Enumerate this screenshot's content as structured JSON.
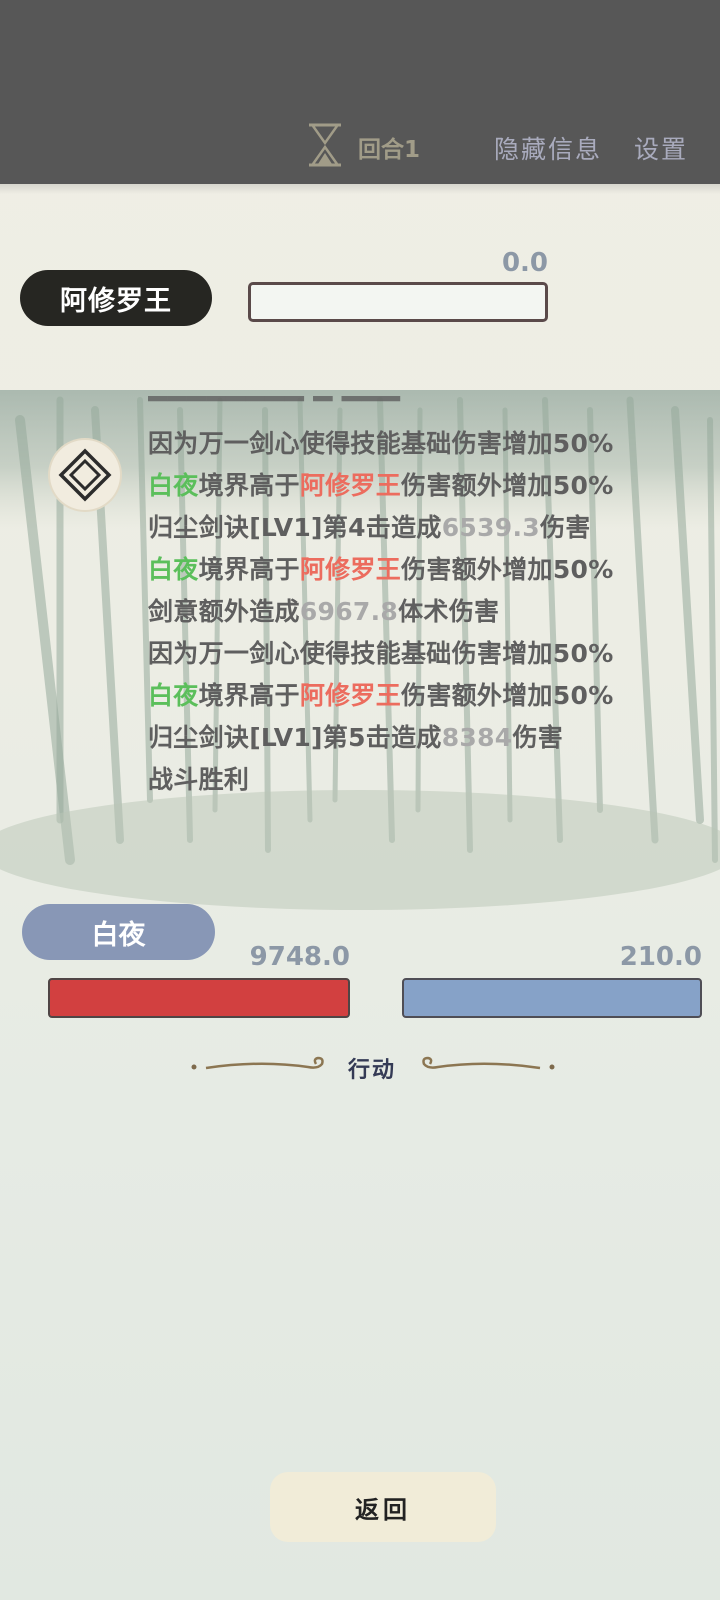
{
  "header": {
    "round_label": "回合1",
    "hide_info_label": "隐藏信息",
    "settings_label": "设置"
  },
  "enemy": {
    "name": "阿修罗王",
    "value": "0.0",
    "bar_fill": 1.0
  },
  "battle_log": [
    [
      {
        "text": "因为万一剑心使得技能基础伤害增加50%",
        "style": "normal"
      }
    ],
    [
      {
        "text": "白夜",
        "style": "green"
      },
      {
        "text": "境界高于",
        "style": "normal"
      },
      {
        "text": "阿修罗王",
        "style": "red"
      },
      {
        "text": "伤害额外增加50%",
        "style": "normal"
      }
    ],
    [
      {
        "text": "归尘剑诀[LV1]第4击造成",
        "style": "normal"
      },
      {
        "text": "6539.3",
        "style": "gray"
      },
      {
        "text": "伤害",
        "style": "normal"
      }
    ],
    [
      {
        "text": "白夜",
        "style": "green"
      },
      {
        "text": "境界高于",
        "style": "normal"
      },
      {
        "text": "阿修罗王",
        "style": "red"
      },
      {
        "text": "伤害额外增加50%",
        "style": "normal"
      }
    ],
    [
      {
        "text": "剑意额外造成",
        "style": "normal"
      },
      {
        "text": "6967.8",
        "style": "gray"
      },
      {
        "text": "体术伤害",
        "style": "normal"
      }
    ],
    [
      {
        "text": "因为万一剑心使得技能基础伤害增加50%",
        "style": "normal"
      }
    ],
    [
      {
        "text": "白夜",
        "style": "green"
      },
      {
        "text": "境界高于",
        "style": "normal"
      },
      {
        "text": "阿修罗王",
        "style": "red"
      },
      {
        "text": "伤害额外增加50%",
        "style": "normal"
      }
    ],
    [
      {
        "text": "归尘剑诀[LV1]第5击造成",
        "style": "normal"
      },
      {
        "text": "8384",
        "style": "gray"
      },
      {
        "text": "伤害",
        "style": "normal"
      }
    ],
    [
      {
        "text": "战斗胜利",
        "style": "normal"
      }
    ]
  ],
  "player": {
    "name": "白夜",
    "hp_value": "9748.0",
    "hp_fill": 1.0,
    "mp_value": "210.0",
    "mp_fill": 1.0
  },
  "action_label": "行动",
  "back_button_label": "返回",
  "colors": {
    "topbar": "#575757",
    "hp": "#d24040",
    "mp": "#86a2c8",
    "log_green": "#5bbf5b",
    "log_red": "#ec6c5e"
  },
  "icons": [
    "hourglass-icon",
    "diamond-skill-icon",
    "ornament-divider"
  ]
}
